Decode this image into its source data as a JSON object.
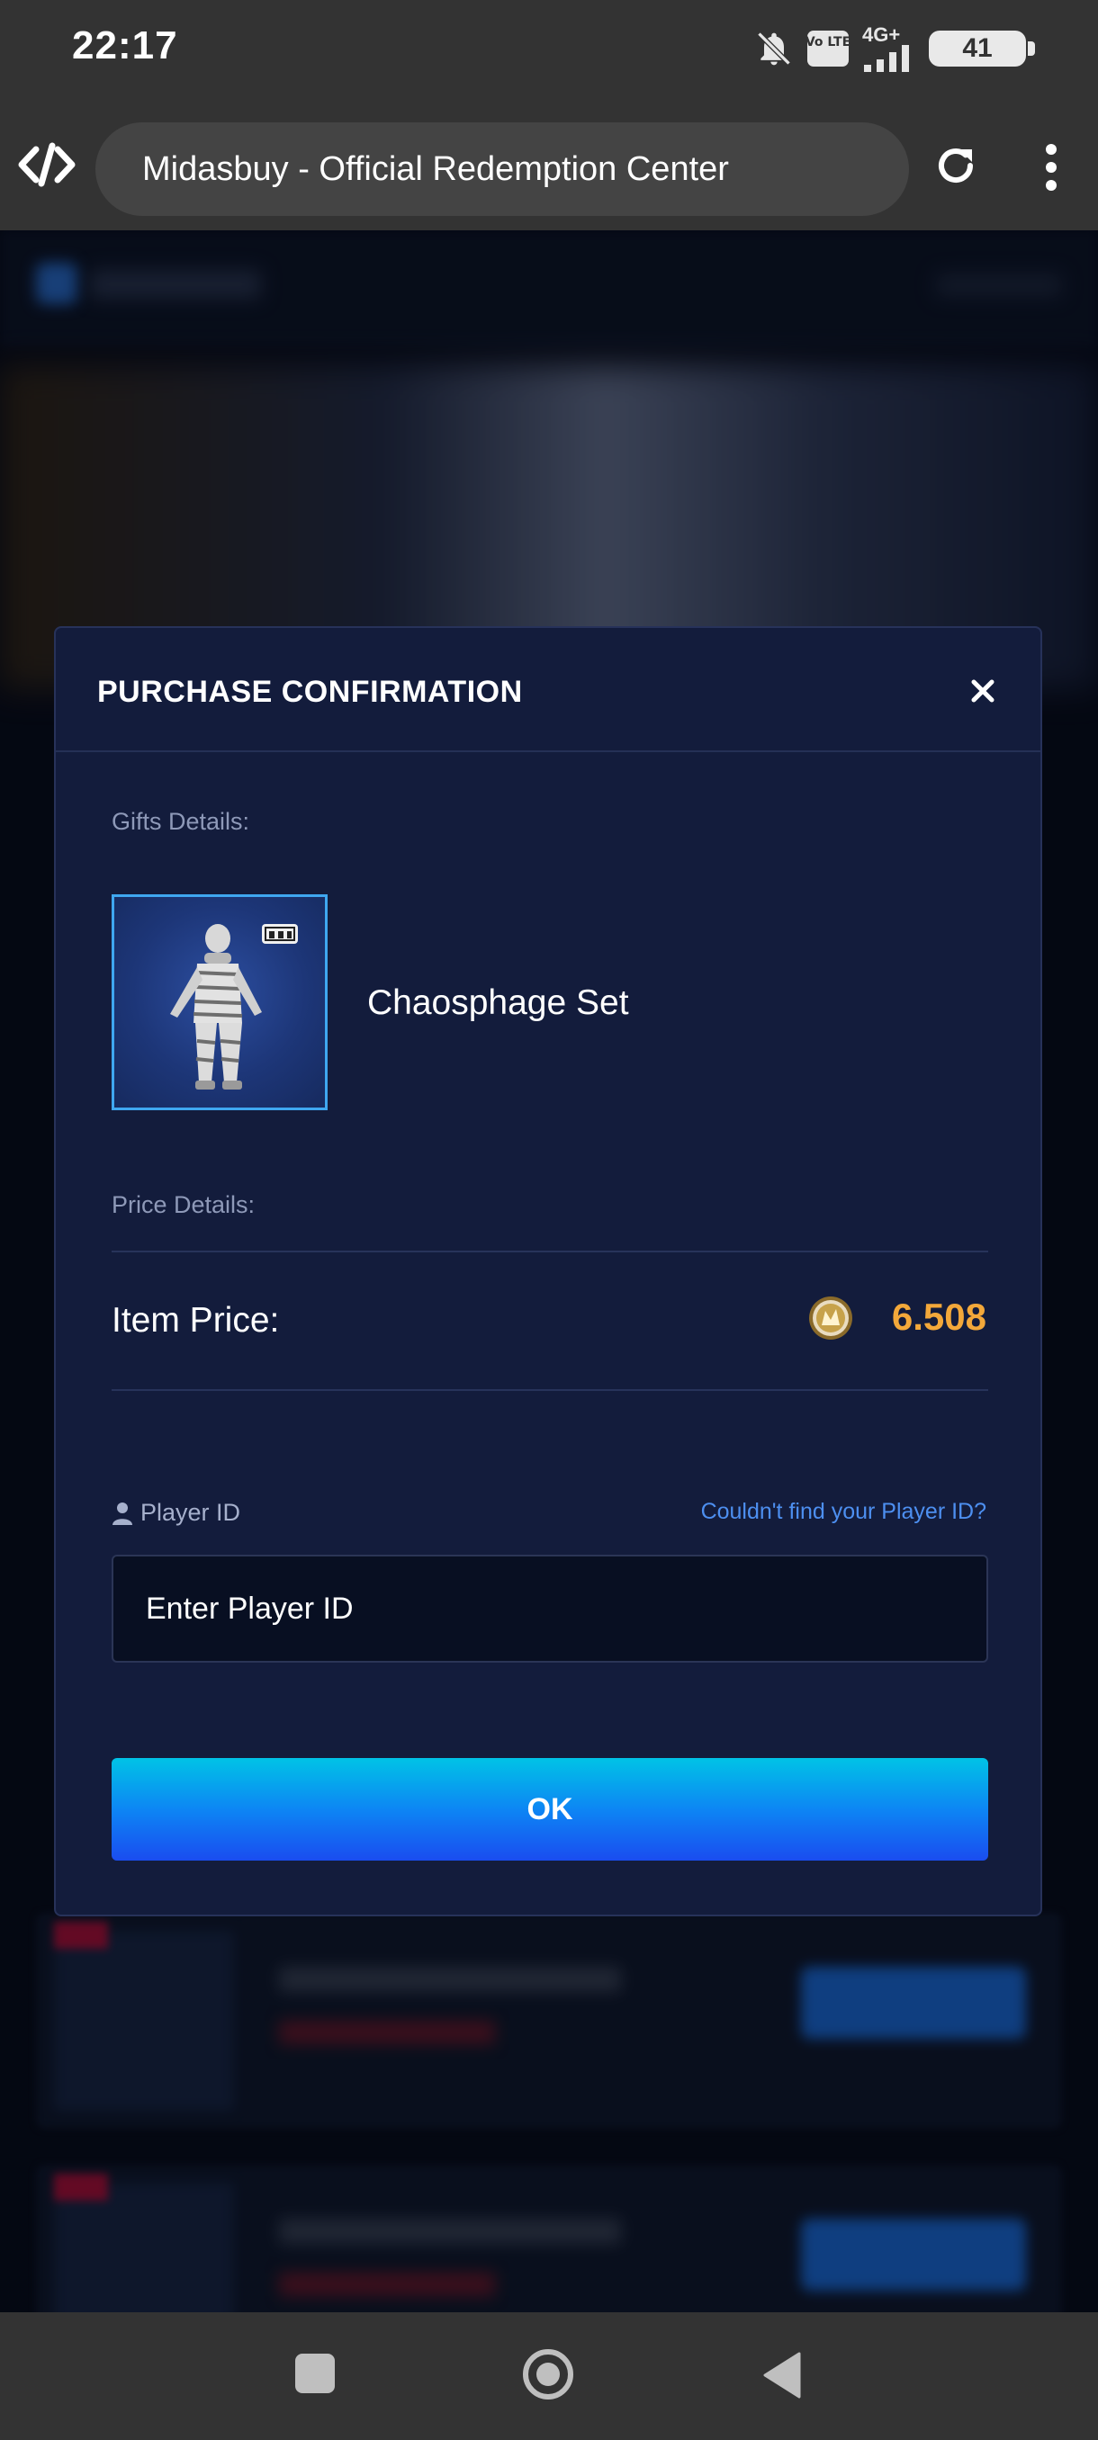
{
  "status_bar": {
    "time": "22:17",
    "network_badge": "Vo LTE",
    "network_type": "4G+",
    "battery": "41"
  },
  "browser": {
    "tab_title": "Midasbuy - Official Redemption Center",
    "icons": [
      "browser-logo-icon",
      "reload-icon",
      "more-vert-icon"
    ]
  },
  "modal": {
    "title": "PURCHASE CONFIRMATION",
    "close_icon": "close-icon",
    "gifts_details_label": "Gifts Details:",
    "gift_name": "Chaosphage Set",
    "price_details_label": "Price Details:",
    "item_price_label": "Item Price:",
    "item_price_value": "6.508",
    "currency_icon": "coin-icon",
    "player_id_label": "Player ID",
    "player_id_help": "Couldn't find your Player ID?",
    "player_id_placeholder": "Enter Player ID",
    "ok_label": "OK"
  },
  "colors": {
    "modal_bg": "#131c3c",
    "price_accent": "#f3a83a",
    "link": "#4d8ff0",
    "button_gradient_top": "#00c3e6",
    "button_gradient_bottom": "#1a4df0",
    "thumb_border": "#3fa7f0"
  },
  "nav_bar": {
    "icons": [
      "recent-apps-icon",
      "home-icon",
      "back-icon"
    ]
  }
}
